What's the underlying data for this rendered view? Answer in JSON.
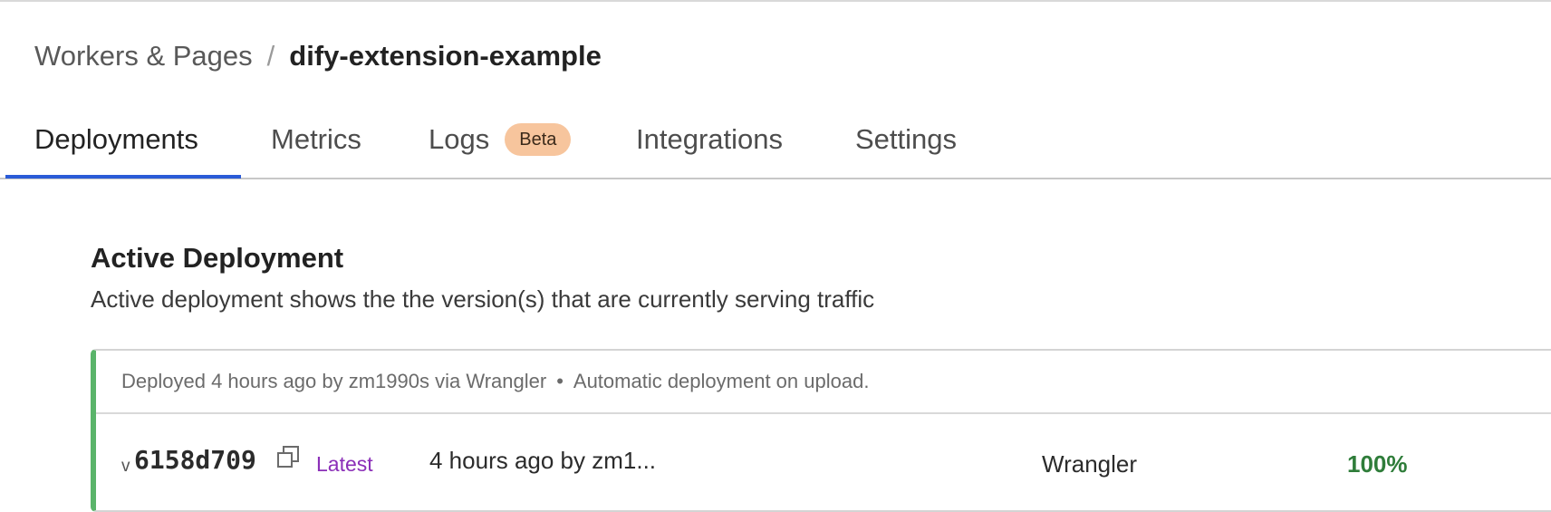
{
  "breadcrumb": {
    "parent": "Workers & Pages",
    "separator": "/",
    "current": "dify-extension-example"
  },
  "tabs": [
    {
      "label": "Deployments",
      "active": true
    },
    {
      "label": "Metrics",
      "active": false
    },
    {
      "label": "Logs",
      "active": false,
      "badge": "Beta"
    },
    {
      "label": "Integrations",
      "active": false
    },
    {
      "label": "Settings",
      "active": false
    }
  ],
  "active_deployment": {
    "title": "Active Deployment",
    "subtitle": "Active deployment shows the the version(s) that are currently serving traffic",
    "header": {
      "deployed_text": "Deployed 4 hours ago by zm1990s via Wrangler",
      "separator": "•",
      "note": "Automatic deployment on upload."
    },
    "version": {
      "prefix": "v",
      "id": "6158d709",
      "copy_icon": "copy-icon",
      "tag": "Latest",
      "created": "4 hours ago by zm1...",
      "source": "Wrangler",
      "traffic": "100%"
    }
  },
  "colors": {
    "accent_tab": "#2a5bd7",
    "badge_bg": "#f7c59d",
    "active_border": "#5ab46a",
    "latest": "#8b2fb8",
    "traffic": "#2f7d3a"
  }
}
